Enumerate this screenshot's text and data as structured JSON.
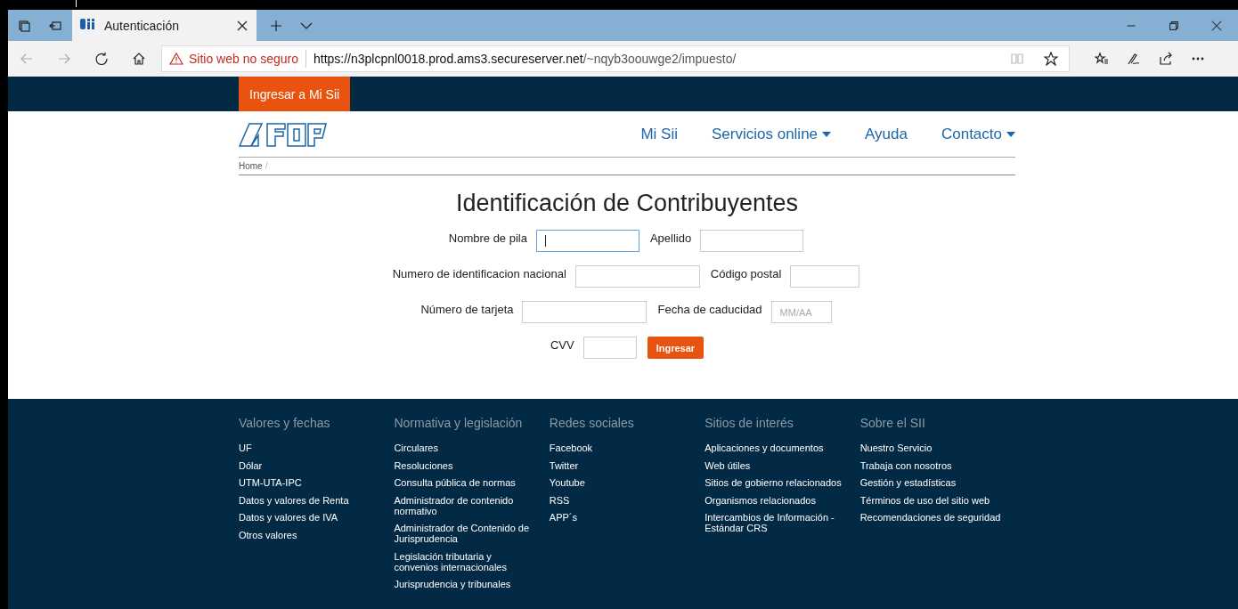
{
  "browser": {
    "tab": {
      "title": "Autenticación",
      "selected": true
    },
    "security_warning": "Sitio web no seguro",
    "url_host": "https://n3plcpnl0018.prod.ams3.secureserver.net",
    "url_path": "/~nqyb3oouwge2/impuesto/"
  },
  "top_bar": {
    "login_button": "Ingresar a Mi Sii"
  },
  "nav": {
    "items": [
      {
        "label": "Mi Sii",
        "dropdown": false
      },
      {
        "label": "Servicios online",
        "dropdown": true
      },
      {
        "label": "Ayuda",
        "dropdown": false
      },
      {
        "label": "Contacto",
        "dropdown": true
      }
    ]
  },
  "breadcrumb": [
    {
      "label": "Home",
      "separator": "/"
    }
  ],
  "form": {
    "title": "Identificación de Contribuyentes",
    "rows": [
      [
        {
          "label": "Nombre de pila",
          "focused": true,
          "kind": "name"
        },
        {
          "label": "Apellido",
          "focused": false,
          "kind": "name"
        }
      ],
      [
        {
          "label": "Numero de identificacion nacional",
          "focused": false,
          "kind": "id"
        },
        {
          "label": "Código postal",
          "focused": false,
          "kind": "postal"
        }
      ],
      [
        {
          "label": "Número de tarjeta",
          "focused": false,
          "kind": "card"
        },
        {
          "label": "Fecha de caducidad",
          "focused": false,
          "kind": "expiry",
          "placeholder": "MM/AA"
        }
      ],
      [
        {
          "label": "CVV",
          "focused": false,
          "kind": "cvv"
        }
      ]
    ],
    "submit": "Ingresar"
  },
  "footer": {
    "columns": [
      {
        "heading": "Valores y fechas",
        "links": [
          "UF",
          "Dólar",
          "UTM-UTA-IPC",
          "Datos y valores de Renta",
          "Datos y valores de IVA",
          "Otros valores"
        ]
      },
      {
        "heading": "Normativa y legislación",
        "links": [
          "Circulares",
          "Resoluciones",
          "Consulta pública de normas",
          "Administrador de contenido normativo",
          "Administrador de Contenido de Jurisprudencia",
          "Legislación tributaria y convenios internacionales",
          "Jurisprudencia y tribunales"
        ]
      },
      {
        "heading": "Redes sociales",
        "links": [
          "Facebook",
          "Twitter",
          "Youtube",
          "RSS",
          "APP´s"
        ]
      },
      {
        "heading": "Sitios de interés",
        "links": [
          "Aplicaciones y documentos",
          "Web útiles",
          "Sitios de gobierno relacionados",
          "Organismos relacionados",
          "Intercambios de Información - Estándar CRS"
        ]
      },
      {
        "heading": "Sobre el SII",
        "links": [
          "Nuestro Servicio",
          "Trabaja con nosotros",
          "Gestión y estadísticas",
          "Términos de uso del sitio web",
          "Recomendaciones de seguridad"
        ]
      }
    ]
  }
}
